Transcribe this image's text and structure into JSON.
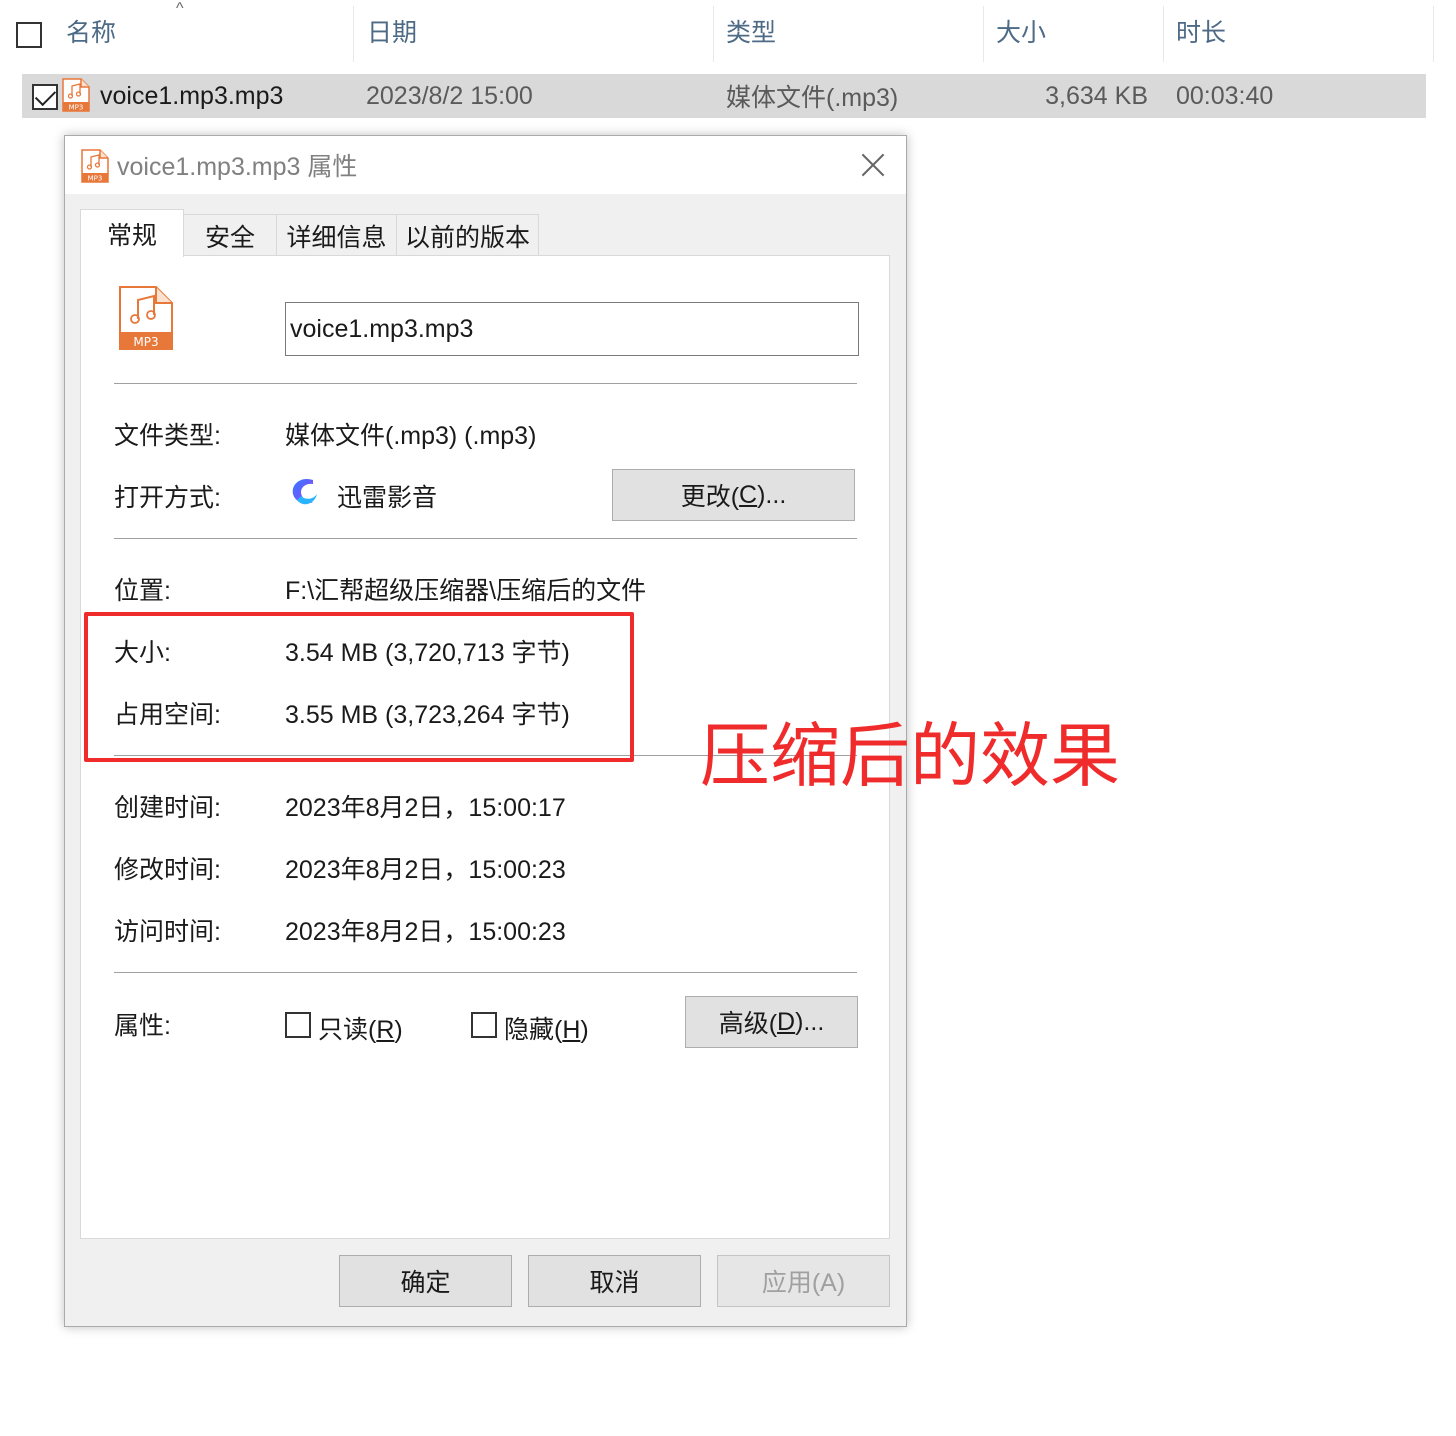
{
  "explorer": {
    "columns": {
      "name": "名称",
      "date": "日期",
      "type": "类型",
      "size": "大小",
      "duration": "时长"
    },
    "file": {
      "name": "voice1.mp3.mp3",
      "date": "2023/8/2 15:00",
      "type": "媒体文件(.mp3)",
      "size": "3,634 KB",
      "duration": "00:03:40",
      "icon": "mp3-file-icon",
      "icon_label": "MP3"
    }
  },
  "dialog": {
    "title": "voice1.mp3.mp3 属性",
    "tabs": [
      "常规",
      "安全",
      "详细信息",
      "以前的版本"
    ],
    "file_name_value": "voice1.mp3.mp3",
    "icon_label": "MP3",
    "file_type_label": "文件类型:",
    "file_type_value": "媒体文件(.mp3) (.mp3)",
    "open_with_label": "打开方式:",
    "open_with_value": "迅雷影音",
    "change_btn_main": "更改(",
    "change_btn_key": "C",
    "change_btn_tail": ")...",
    "location_label": "位置:",
    "location_value": "F:\\汇帮超级压缩器\\压缩后的文件",
    "size_label": "大小:",
    "size_value": "3.54 MB (3,720,713 字节)",
    "disk_size_label": "占用空间:",
    "disk_size_value": "3.55 MB (3,723,264 字节)",
    "created_label": "创建时间:",
    "created_value": "2023年8月2日，15:00:17",
    "modified_label": "修改时间:",
    "modified_value": "2023年8月2日，15:00:23",
    "accessed_label": "访问时间:",
    "accessed_value": "2023年8月2日，15:00:23",
    "attributes_label": "属性:",
    "readonly_main": "只读(",
    "readonly_key": "R",
    "readonly_tail": ")",
    "hidden_main": "隐藏(",
    "hidden_key": "H",
    "hidden_tail": ")",
    "advanced_main": "高级(",
    "advanced_key": "D",
    "advanced_tail": ")...",
    "ok_label": "确定",
    "cancel_label": "取消",
    "apply_label": "应用(A)"
  },
  "annotation": {
    "text": "压缩后的效果",
    "color": "#ef2b2b"
  }
}
